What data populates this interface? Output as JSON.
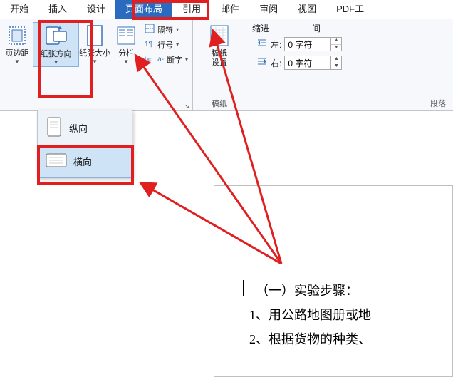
{
  "tabs": {
    "start": "开始",
    "insert": "插入",
    "design": "设计",
    "layout": "页面布局",
    "references": "引用",
    "mail": "邮件",
    "review": "审阅",
    "view": "视图",
    "pdf": "PDF工"
  },
  "ribbon": {
    "margins": "页边距",
    "orientation": "纸张方向",
    "size": "纸张大小",
    "columns": "分栏",
    "breaks": "隔符",
    "line_numbers": "行号",
    "hyphenation": "断字",
    "manuscript": "稿纸\n设置",
    "manuscript_group": "稿纸",
    "indent_title": "缩进",
    "indent_left_label": "左:",
    "indent_right_label": "右:",
    "indent_left_val": "0 字符",
    "indent_right_val": "0 字符",
    "spacing_title": "间",
    "paragraph_group": "段落"
  },
  "orientation_menu": {
    "portrait": "纵向",
    "landscape": "横向"
  },
  "document": {
    "heading": "（一）实验步骤：",
    "item1": "1、用公路地图册或地",
    "item2": "2、根据货物的种类、"
  },
  "colors": {
    "accent": "#2a6bbf",
    "highlight_bg": "#cfe3f7",
    "highlight_border": "#8ab1de",
    "annotation": "#e02020"
  }
}
